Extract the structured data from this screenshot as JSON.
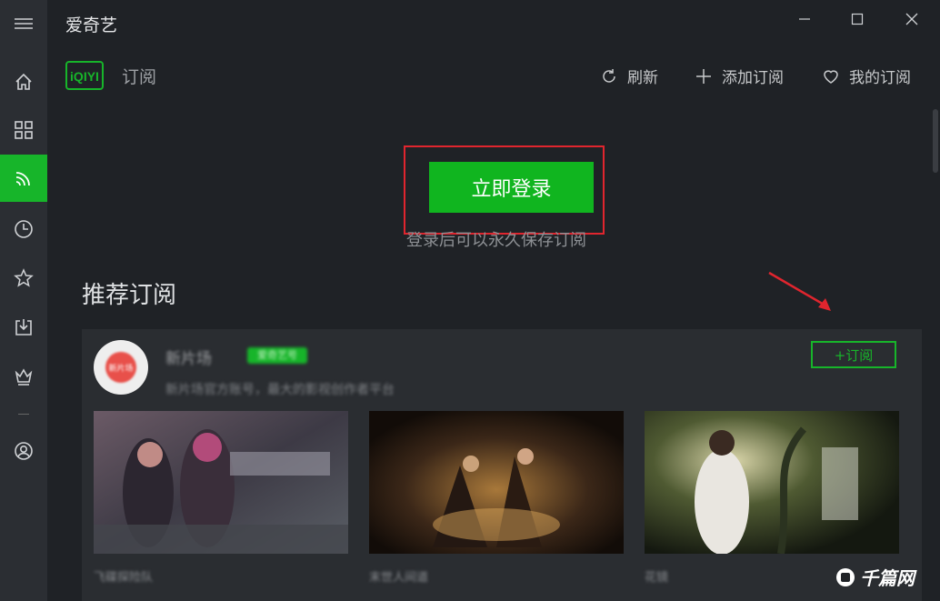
{
  "app": {
    "title": "爱奇艺"
  },
  "sidebar": {
    "items": [
      {
        "name": "home",
        "icon": "home-icon",
        "active": false
      },
      {
        "name": "categories",
        "icon": "grid-icon",
        "active": false
      },
      {
        "name": "subscriptions",
        "icon": "rss-icon",
        "active": true
      },
      {
        "name": "history",
        "icon": "clock-icon",
        "active": false
      },
      {
        "name": "favorites",
        "icon": "star-icon",
        "active": false
      },
      {
        "name": "downloads",
        "icon": "download-icon",
        "active": false
      },
      {
        "name": "vip",
        "icon": "crown-icon",
        "active": false
      },
      {
        "name": "account",
        "icon": "user-icon",
        "active": false
      }
    ]
  },
  "header": {
    "logo_text": "iQIYI",
    "page_title": "订阅",
    "refresh_label": "刷新",
    "add_label": "添加订阅",
    "my_subs_label": "我的订阅"
  },
  "login": {
    "button_label": "立即登录",
    "note": "登录后可以永久保存订阅"
  },
  "recommended": {
    "title": "推荐订阅",
    "channel": {
      "avatar_text": "新片场",
      "name": "新片场",
      "badge": "爱奇艺号",
      "description": "新片场官方账号，最大的影视创作者平台",
      "subscribe_label": "+订阅"
    },
    "videos": [
      {
        "caption": "飞碟探险队"
      },
      {
        "caption": "末世人间道"
      },
      {
        "caption": "花镜"
      }
    ]
  },
  "watermark": {
    "text": "千篇网"
  },
  "colors": {
    "accent": "#17b52a",
    "highlight": "#e0252e",
    "background": "#1f2226"
  }
}
